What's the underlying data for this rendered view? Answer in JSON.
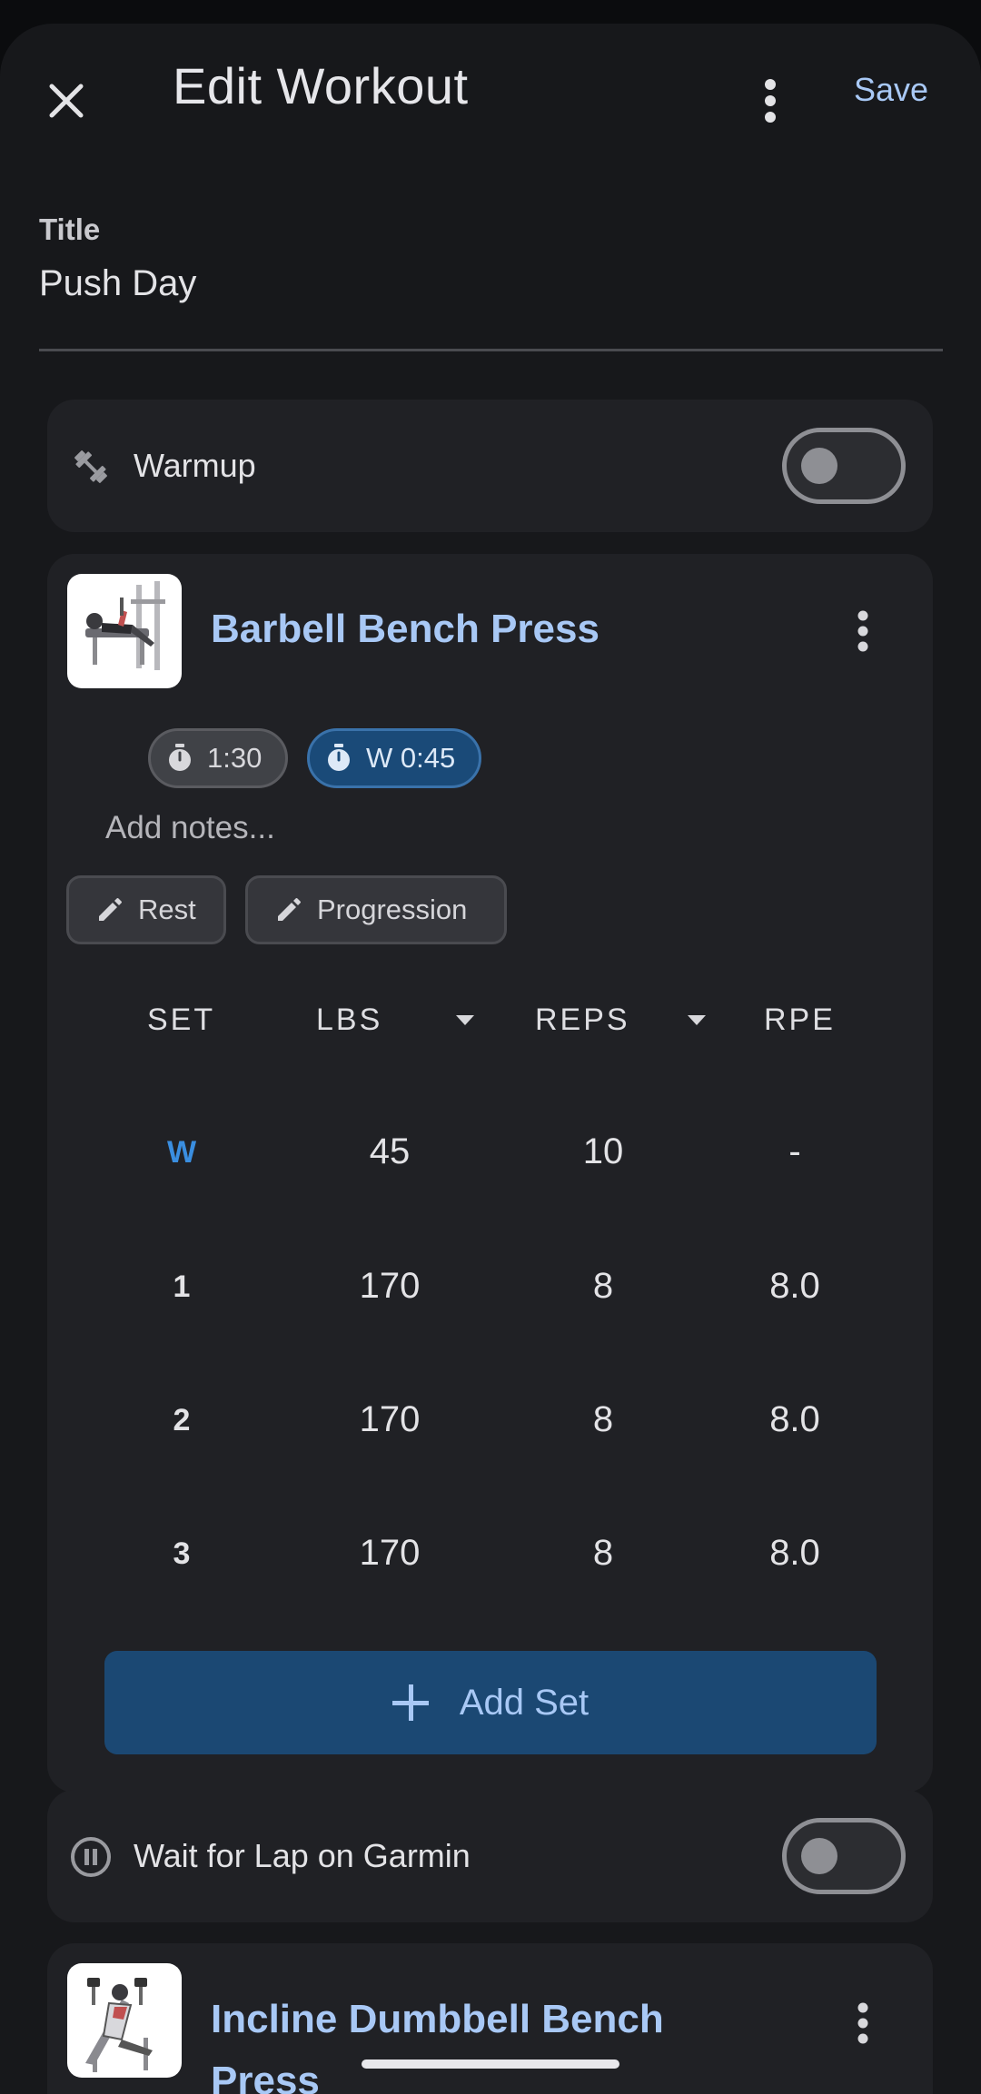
{
  "header": {
    "title": "Edit Workout",
    "save_label": "Save",
    "icons": {
      "close": "close-icon",
      "more": "more-vert-icon"
    }
  },
  "title_field": {
    "label": "Title",
    "value": "Push Day"
  },
  "warmup": {
    "label": "Warmup",
    "icon": "dumbbell-icon",
    "enabled": false
  },
  "exercise": {
    "name": "Barbell Bench Press",
    "rest_chip": "1:30",
    "warmup_rest_chip": "W 0:45",
    "notes_placeholder": "Add notes...",
    "buttons": {
      "rest": "Rest",
      "progression": "Progression"
    },
    "columns": {
      "set": "SET",
      "lbs": "LBS",
      "reps": "REPS",
      "rpe": "RPE"
    },
    "sets": [
      {
        "set": "W",
        "lbs": "45",
        "reps": "10",
        "rpe": "-",
        "warmup": true
      },
      {
        "set": "1",
        "lbs": "170",
        "reps": "8",
        "rpe": "8.0",
        "warmup": false
      },
      {
        "set": "2",
        "lbs": "170",
        "reps": "8",
        "rpe": "8.0",
        "warmup": false
      },
      {
        "set": "3",
        "lbs": "170",
        "reps": "8",
        "rpe": "8.0",
        "warmup": false
      }
    ],
    "add_set_label": "Add Set"
  },
  "garmin": {
    "label": "Wait for Lap on Garmin",
    "icon": "pause-circle-icon",
    "enabled": false
  },
  "next_exercise": {
    "name": "Incline Dumbbell Bench Press"
  },
  "colors": {
    "accent": "#a8c8f5",
    "warmup_set": "#3a8ee0",
    "button_bg": "#1b4873",
    "card_bg": "#202125"
  }
}
